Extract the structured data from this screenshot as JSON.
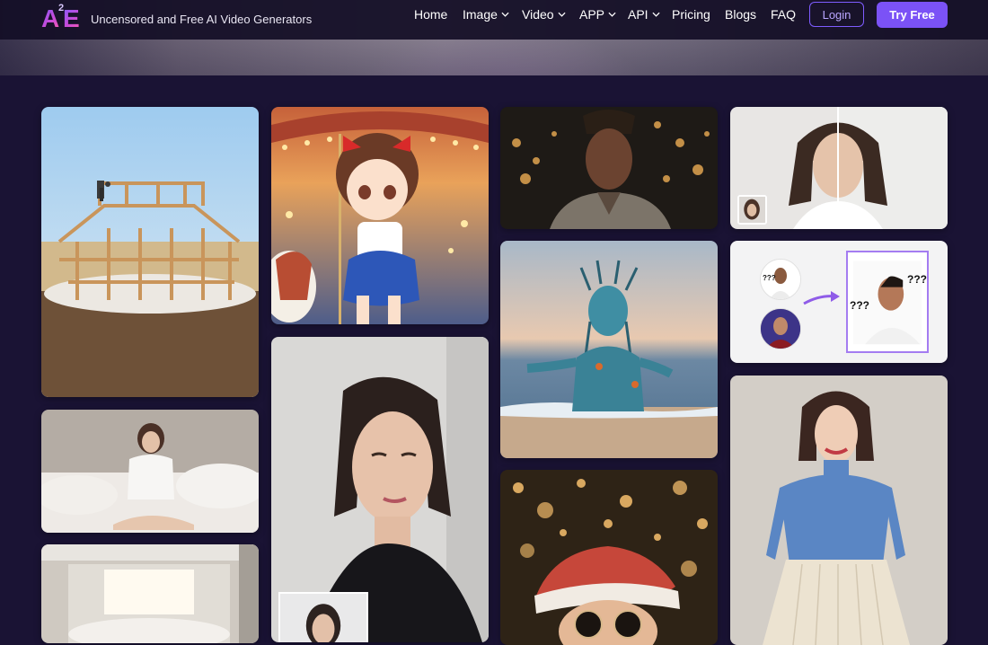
{
  "header": {
    "logo": {
      "letter_a": "A",
      "superscript": "2",
      "letter_e": "E"
    },
    "tagline": "Uncensored and Free AI Video Generators",
    "nav": [
      {
        "label": "Home",
        "has_dropdown": false
      },
      {
        "label": "Image",
        "has_dropdown": true
      },
      {
        "label": "Video",
        "has_dropdown": true
      },
      {
        "label": "APP",
        "has_dropdown": true
      },
      {
        "label": "API",
        "has_dropdown": true
      },
      {
        "label": "Pricing",
        "has_dropdown": false
      },
      {
        "label": "Blogs",
        "has_dropdown": false
      },
      {
        "label": "FAQ",
        "has_dropdown": false
      }
    ],
    "login_label": "Login",
    "try_free_label": "Try Free"
  },
  "colors": {
    "page_bg": "#1a1334",
    "header_bg": "#130e26",
    "accent": "#7b52f6",
    "login_border": "#7e5cff"
  },
  "gallery": {
    "tiles": [
      {
        "id": "wooden-frame-construction",
        "column": 1
      },
      {
        "id": "woman-on-bed",
        "column": 1
      },
      {
        "id": "bright-bedroom",
        "column": 1
      },
      {
        "id": "anime-girl-carousel",
        "column": 2
      },
      {
        "id": "dark-haired-woman-portrait",
        "column": 2
      },
      {
        "id": "man-with-dreadlocks",
        "column": 3
      },
      {
        "id": "sea-creature-on-beach",
        "column": 3
      },
      {
        "id": "santa-with-sunglasses",
        "column": 3
      },
      {
        "id": "woman-before-after",
        "column": 4
      },
      {
        "id": "face-swap-demo",
        "column": 4
      },
      {
        "id": "woman-blue-top",
        "column": 4
      }
    ],
    "face_swap_labels": [
      "???",
      "???",
      "???",
      "???"
    ]
  }
}
